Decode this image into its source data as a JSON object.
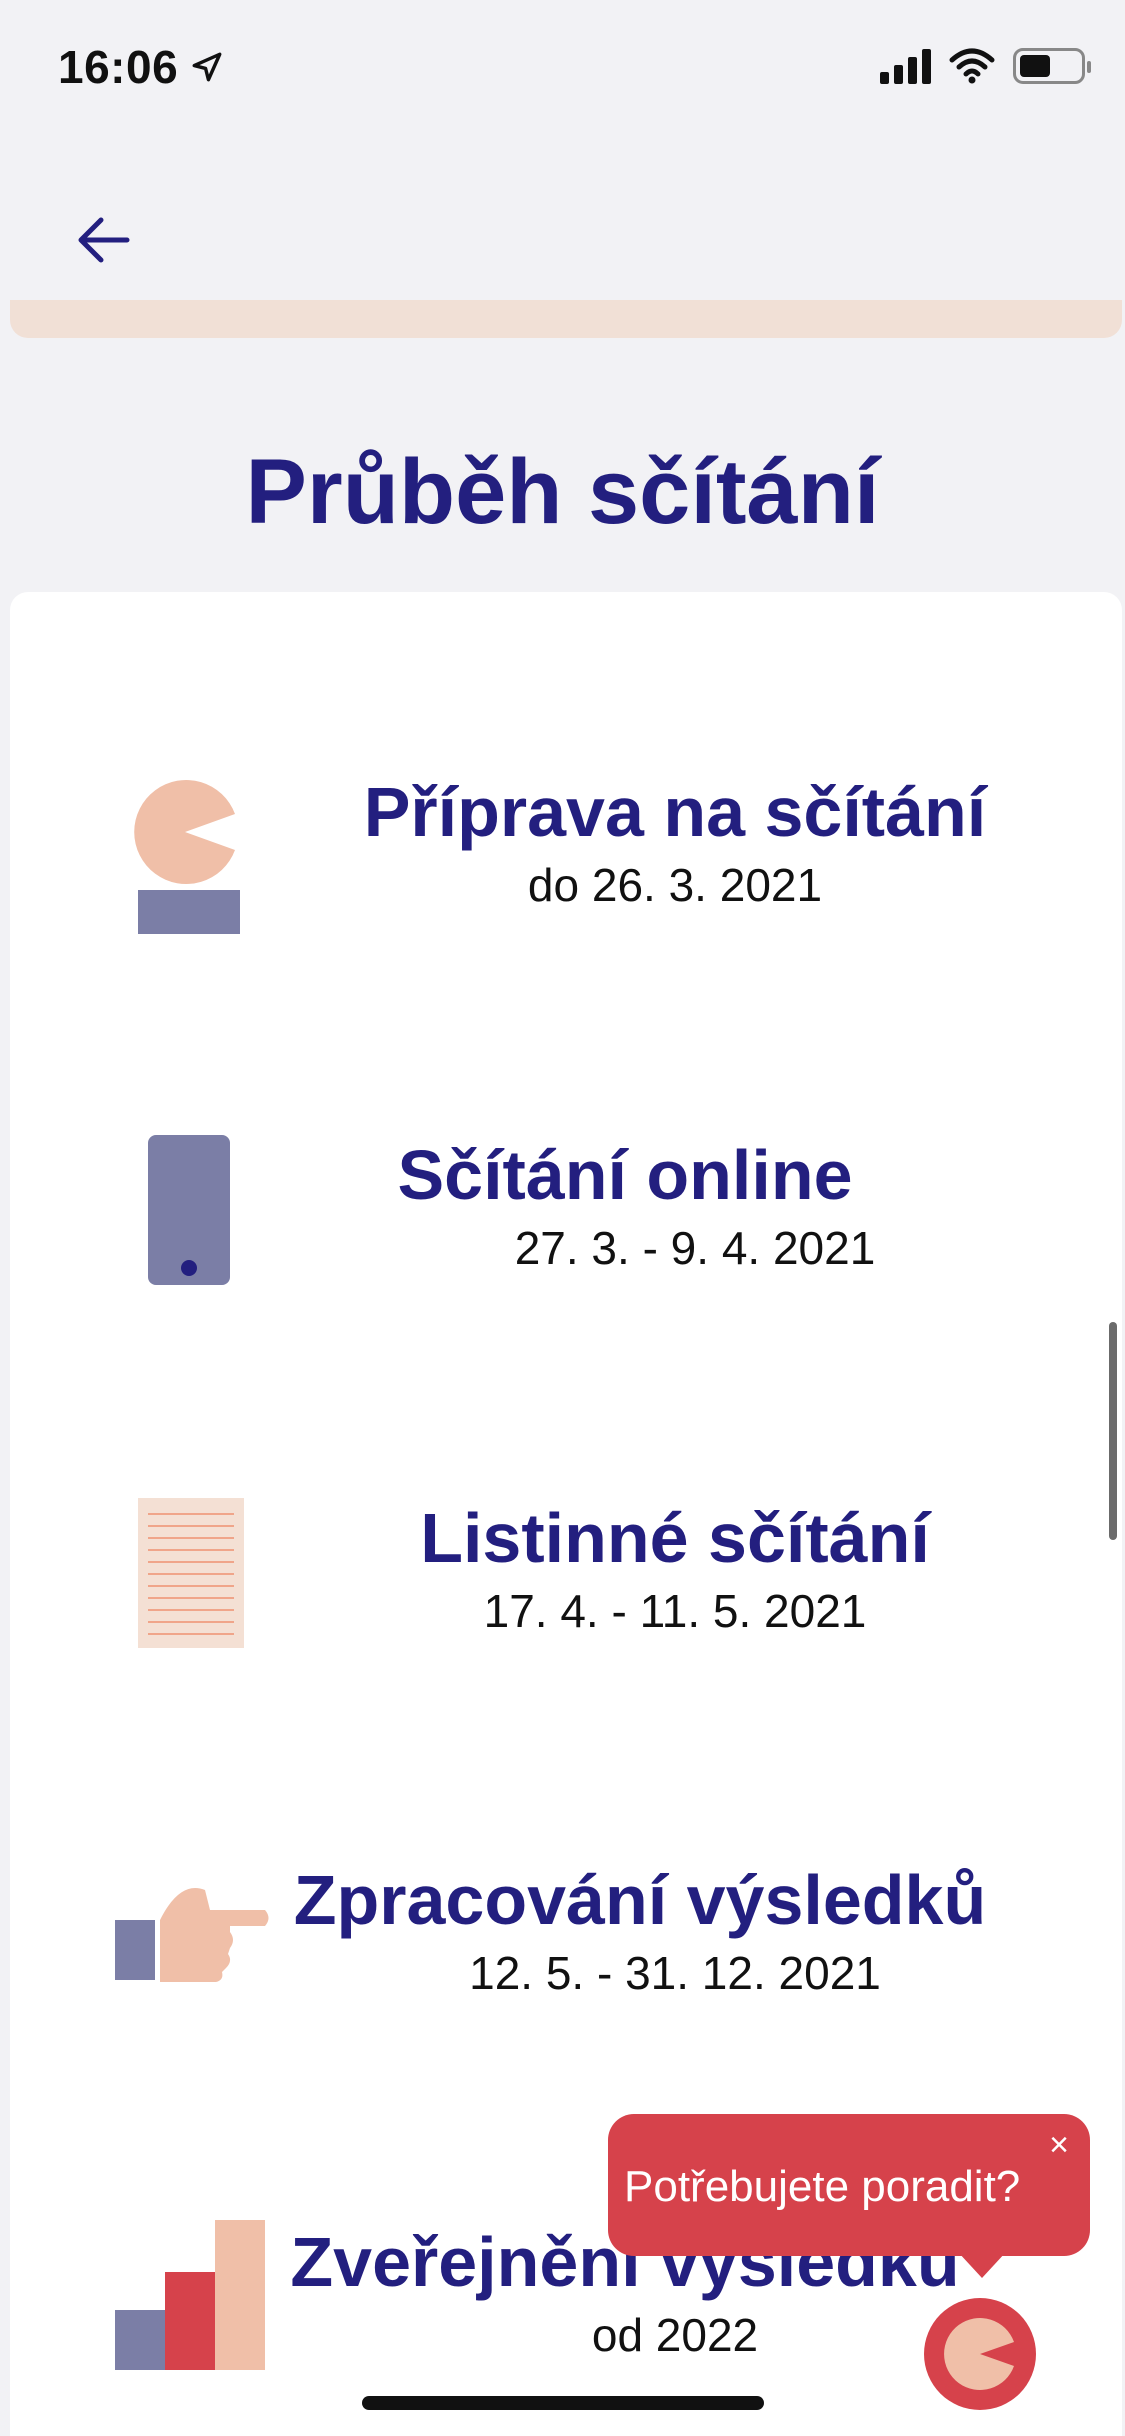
{
  "status_bar": {
    "time": "16:06"
  },
  "page": {
    "title": "Průběh sčítání"
  },
  "steps": [
    {
      "title": "Příprava na sčítání",
      "date": "do 26. 3. 2021",
      "icon": "pacman-podium-icon"
    },
    {
      "title": "Sčítání online",
      "date": "27. 3. - 9. 4. 2021",
      "icon": "smartphone-icon"
    },
    {
      "title": "Listinné sčítání",
      "date": "17. 4. - 11. 5. 2021",
      "icon": "paper-form-icon"
    },
    {
      "title": "Zpracování výsledků",
      "date": "12. 5. - 31. 12. 2021",
      "icon": "pointing-hand-icon"
    },
    {
      "title": "Zveřejnění výsledků",
      "date": "od 2022",
      "icon": "bar-chart-icon"
    }
  ],
  "help": {
    "bubble_text": "Potřebujete poradit?",
    "close_label": "×"
  },
  "colors": {
    "title": "#231f7f",
    "peach": "#f0bfa8",
    "slate": "#7b7ea6",
    "red": "#d6424b",
    "paper": "#f4e0d4"
  }
}
